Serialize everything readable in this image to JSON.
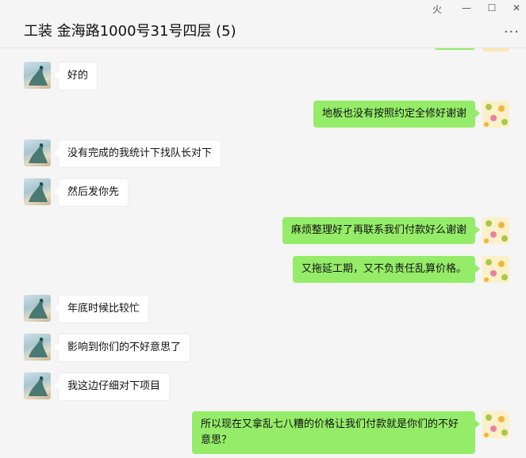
{
  "window": {
    "title": "工装 金海路1000号31号四层 (5)",
    "controls": {
      "pin": "⽕",
      "minimize": "—",
      "maximize": "☐",
      "close": "✕"
    },
    "more": "···"
  },
  "messages": [
    {
      "side": "left",
      "text": "好的"
    },
    {
      "side": "right",
      "text": "地板也没有按照约定全修好谢谢"
    },
    {
      "side": "left",
      "text": "没有完成的我统计下找队长对下"
    },
    {
      "side": "left",
      "text": "然后发你先"
    },
    {
      "side": "right",
      "text": "麻烦整理好了再联系我们付款好么谢谢"
    },
    {
      "side": "right",
      "text": "又拖延工期，又不负责任乱算价格。"
    },
    {
      "side": "left",
      "text": "年底时候比较忙"
    },
    {
      "side": "left",
      "text": "影响到你们的不好意思了"
    },
    {
      "side": "left",
      "text": "我这边仔细对下项目"
    },
    {
      "side": "right",
      "text": "所以现在又拿乱七八糟的价格让我们付款就是你们的不好意思？"
    }
  ],
  "colors": {
    "self_bubble": "#95ec69",
    "other_bubble": "#ffffff",
    "background": "#f5f5f5"
  },
  "icons": {
    "other_avatar": "peacock-avatar",
    "self_avatar": "fruit-pattern-avatar"
  }
}
